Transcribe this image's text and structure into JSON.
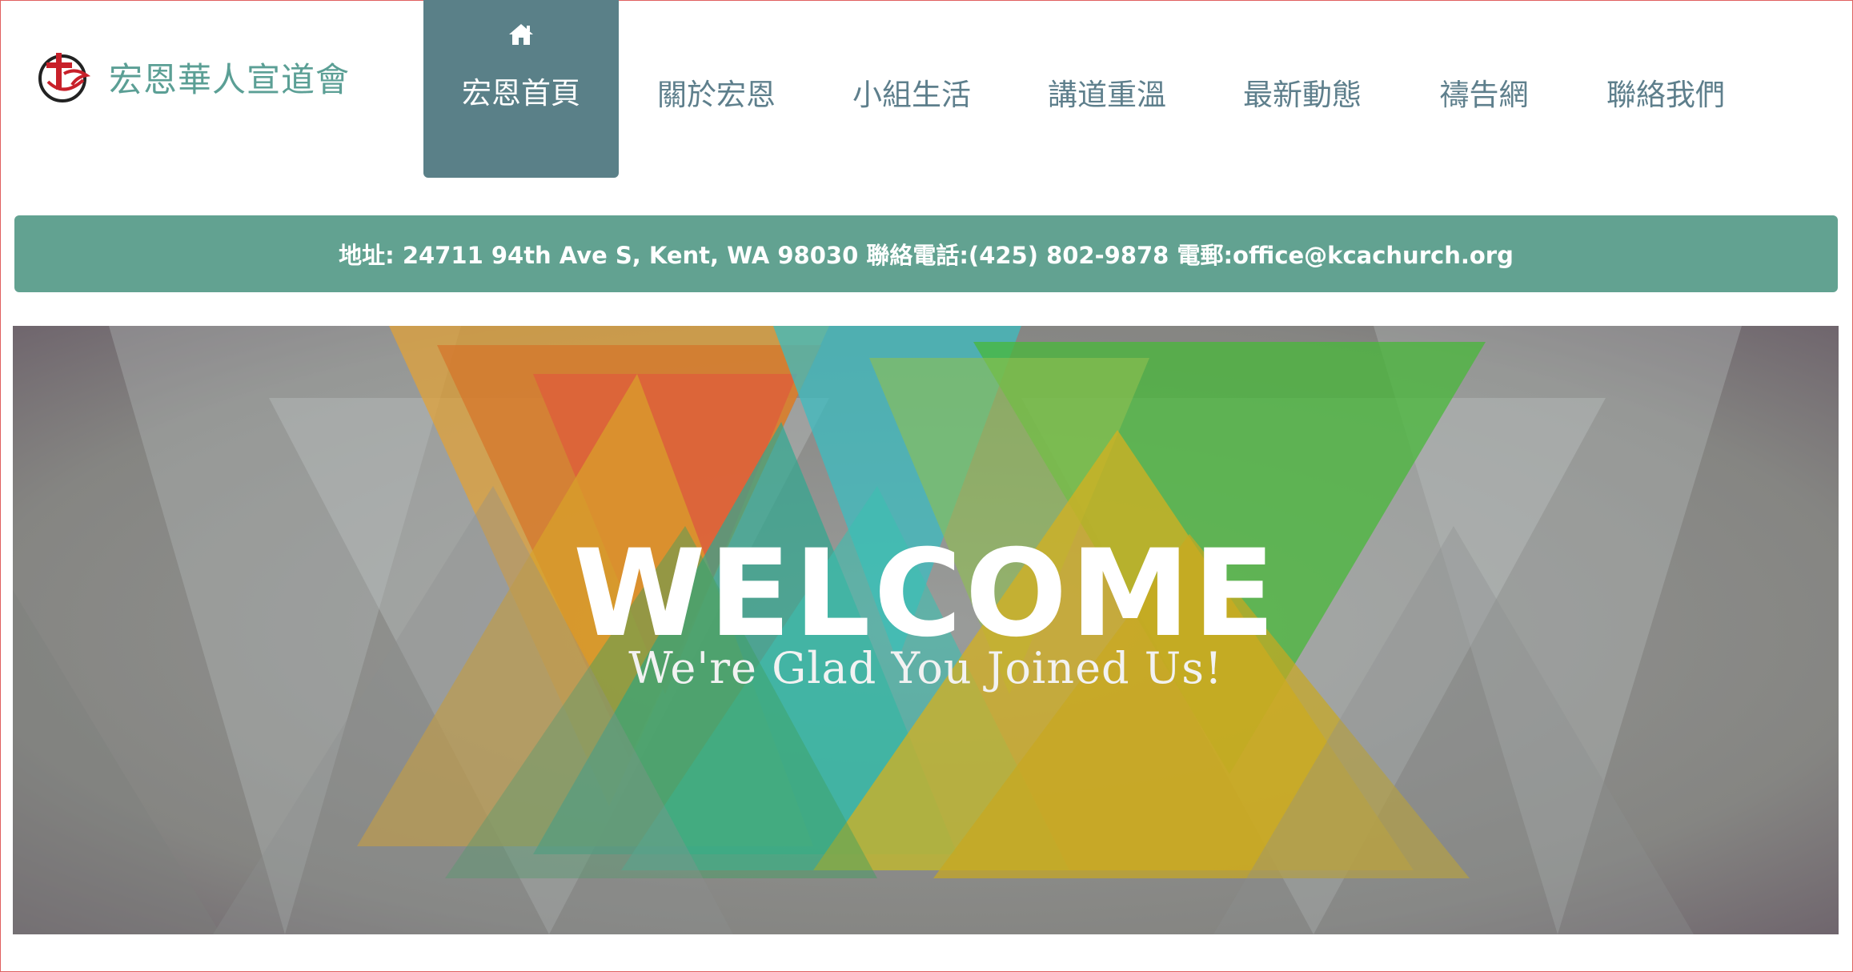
{
  "header": {
    "site_name": "宏恩華人宣道會",
    "logo_icon": "church-logo-icon"
  },
  "nav": {
    "items": [
      {
        "label": "宏恩首頁",
        "icon": "home-icon",
        "active": true
      },
      {
        "label": "關於宏恩"
      },
      {
        "label": "小組生活"
      },
      {
        "label": "講道重溫"
      },
      {
        "label": "最新動態"
      },
      {
        "label": "禱告網"
      },
      {
        "label": "聯絡我們"
      }
    ]
  },
  "info_bar": {
    "text": "地址: 24711 94th Ave S, Kent, WA 98030 聯絡電話:(425) 802-9878 電郵:office@kcachurch.org"
  },
  "banner": {
    "title": "WELCOME",
    "subtitle": "We're Glad You Joined Us!"
  },
  "colors": {
    "accent": "#62a291",
    "nav_active": "#5a8088",
    "nav_text": "#5e7f8c",
    "site_name": "#5b9f95"
  }
}
